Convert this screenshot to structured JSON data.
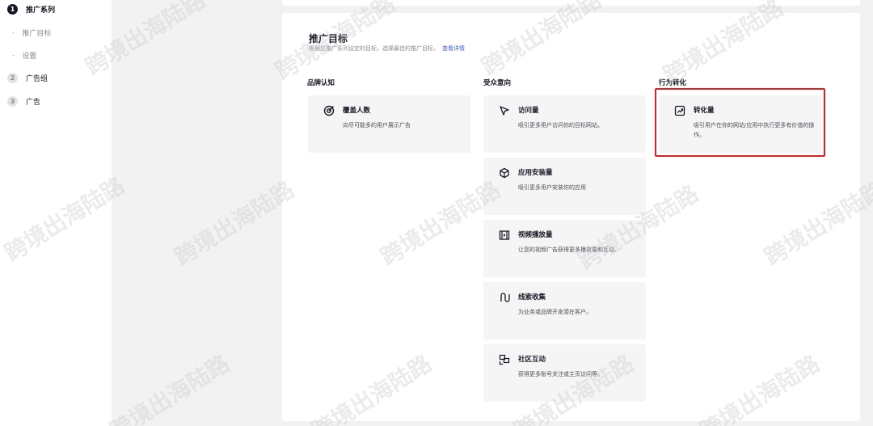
{
  "sidebar": {
    "steps": [
      {
        "num": "1",
        "label": "推广系列"
      },
      {
        "num": "2",
        "label": "广告组"
      },
      {
        "num": "3",
        "label": "广告"
      }
    ],
    "sub_items": [
      {
        "dash": "-",
        "label": "推广目标"
      },
      {
        "dash": "-",
        "label": "设置"
      }
    ]
  },
  "main": {
    "title": "推广目标",
    "subtitle": "根据您推广系列设定的目标，选择最佳的推广目标。",
    "link": "查看详情",
    "columns": [
      {
        "heading": "品牌认知"
      },
      {
        "heading": "受众意向"
      },
      {
        "heading": "行为转化"
      }
    ],
    "objectives": {
      "reach": {
        "name": "覆盖人数",
        "desc": "向尽可能多的用户展示广告",
        "icon": "target-icon"
      },
      "traffic": {
        "name": "访问量",
        "desc": "吸引更多用户访问你的目标网站。",
        "icon": "cursor-arrow-icon"
      },
      "app_install": {
        "name": "应用安装量",
        "desc": "吸引更多用户安装你的应用",
        "icon": "cube-icon"
      },
      "video_views": {
        "name": "视频播放量",
        "desc": "让您的视频广告获得更多播放量和互动。",
        "icon": "film-icon"
      },
      "lead_gen": {
        "name": "线索收集",
        "desc": "为业务或品牌开发潜在客户。",
        "icon": "path-icon"
      },
      "community": {
        "name": "社区互动",
        "desc": "获得更多账号关注或主页访问等。",
        "icon": "community-icon"
      },
      "conversions": {
        "name": "转化量",
        "desc": "吸引用户在你的网站/应用中执行更多有价值的操作。",
        "icon": "trend-up-icon"
      }
    }
  },
  "watermark": "跨境出海陆路",
  "colors": {
    "accent_link": "#3b5bdb",
    "highlight_border": "#e02020"
  }
}
